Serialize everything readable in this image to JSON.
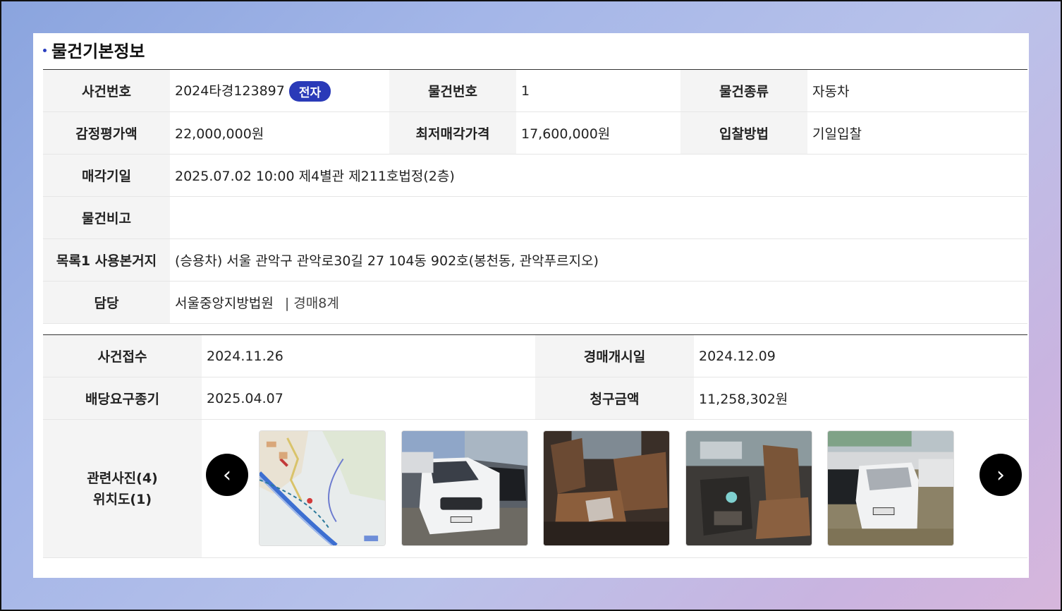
{
  "section_title": "물건기본정보",
  "basic": {
    "case_no_label": "사건번호",
    "case_no": "2024타경123897",
    "electronic_badge": "전자",
    "item_no_label": "물건번호",
    "item_no": "1",
    "item_type_label": "물건종류",
    "item_type": "자동차",
    "appraisal_label": "감정평가액",
    "appraisal": "22,000,000원",
    "min_price_label": "최저매각가격",
    "min_price": "17,600,000원",
    "bid_method_label": "입찰방법",
    "bid_method": "기일입찰",
    "sale_date_label": "매각기일",
    "sale_date": "2025.07.02 10:00 제4별관 제211호법정(2층)",
    "remarks_label": "물건비고",
    "remarks": "",
    "location_label": "목록1 사용본거지",
    "location": "(승용차) 서울 관악구 관악로30길 27 104동 902호(봉천동, 관악푸르지오)",
    "manager_label": "담당",
    "court": "서울중앙지방법원",
    "department": "| 경매8계"
  },
  "case_info": {
    "receipt_label": "사건접수",
    "receipt": "2024.11.26",
    "start_label": "경매개시일",
    "start": "2024.12.09",
    "deadline_label": "배당요구종기",
    "deadline": "2025.04.07",
    "claim_label": "청구금액",
    "claim": "11,258,302원",
    "photos_label_line1": "관련사진(4)",
    "photos_label_line2": "위치도(1)"
  },
  "gallery": {
    "prev_icon": "chevron-left-icon",
    "next_icon": "chevron-right-icon",
    "prev_glyph": "‹",
    "next_glyph": "›",
    "items": [
      "location-map",
      "car-front-photo",
      "car-rear-seat-photo",
      "car-front-seat-photo",
      "car-rear-photo"
    ]
  },
  "colors": {
    "badge": "#2a3ab8",
    "title_dot": "#2b3fc0",
    "header_bg": "#f4f4f4"
  }
}
